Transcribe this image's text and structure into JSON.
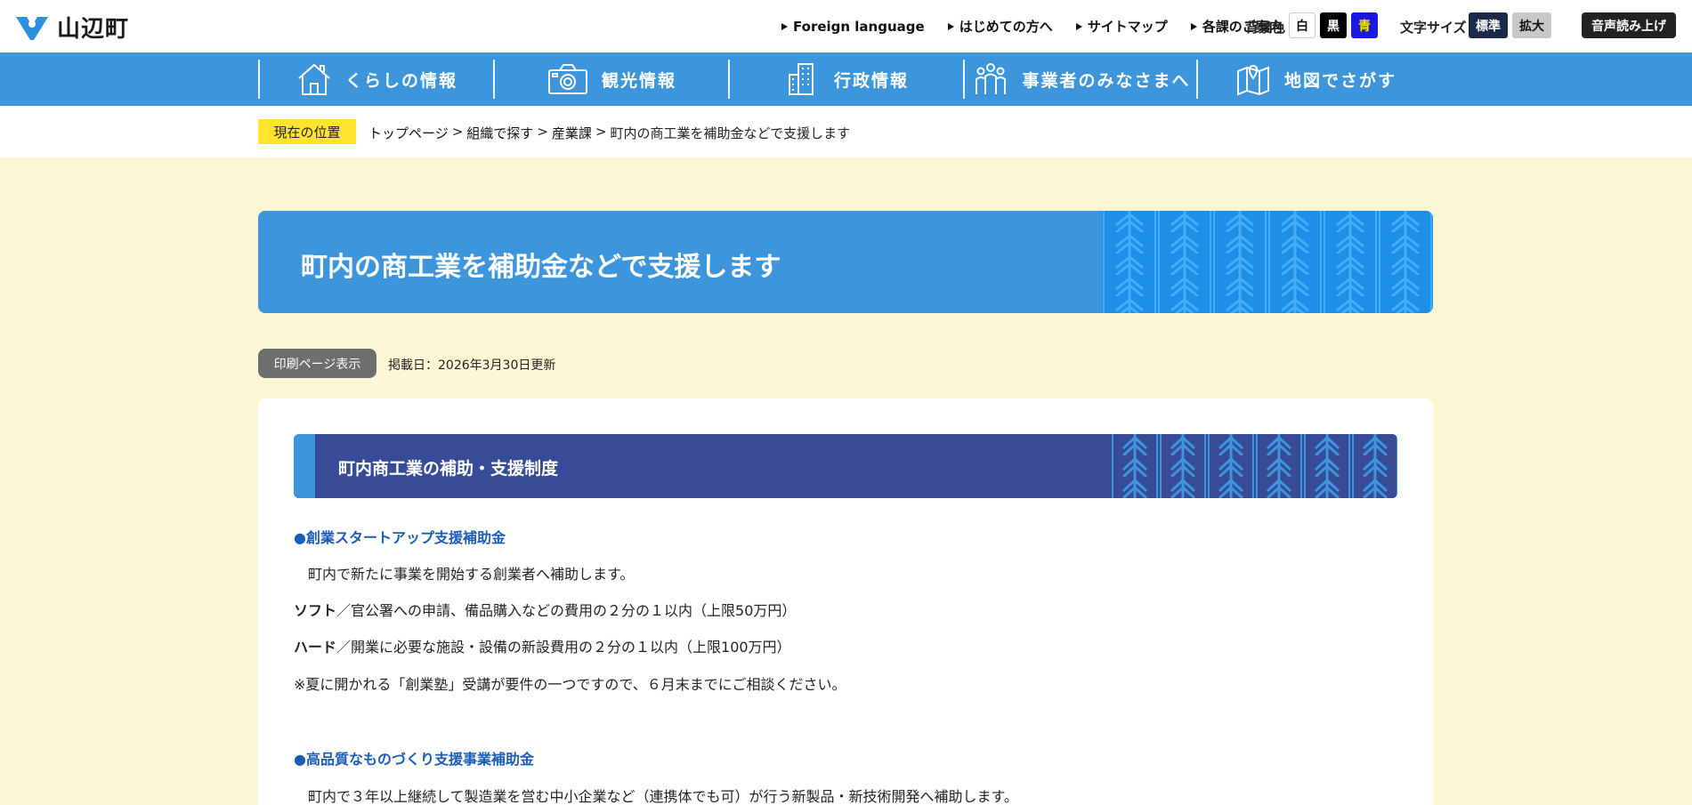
{
  "header": {
    "logo_text": "山辺町",
    "util_links": [
      "Foreign language",
      "はじめての方へ",
      "サイトマップ",
      "各課のご案内"
    ],
    "bg_label": "背景色",
    "bg_white": "白",
    "bg_black": "黒",
    "bg_blue": "青",
    "font_label": "文字サイズ",
    "font_standard": "標準",
    "font_large": "拡大",
    "voice_label": "音声読み上げ"
  },
  "gnav": {
    "items": [
      {
        "label": "くらしの情報",
        "icon": "house-icon"
      },
      {
        "label": "観光情報",
        "icon": "camera-icon"
      },
      {
        "label": "行政情報",
        "icon": "building-icon"
      },
      {
        "label": "事業者のみなさまへ",
        "icon": "people-icon"
      },
      {
        "label": "地図でさがす",
        "icon": "map-icon"
      }
    ]
  },
  "breadcrumb": {
    "here_label": "現在の位置",
    "items": [
      "トップページ",
      "組織で探す",
      "産業課",
      "町内の商工業を補助金などで支援します"
    ],
    "separator": ">"
  },
  "page": {
    "title": "町内の商工業を補助金などで支援します",
    "print_label": "印刷ページ表示",
    "published": "掲載日：2026年3月30日更新"
  },
  "content": {
    "section_title": "町内商工業の補助・支援制度",
    "item1_title": "●創業スタートアップ支援補助金",
    "item1_desc": "町内で新たに事業を開始する創業者へ補助します。",
    "soft_label": "ソフト",
    "soft_text": "／官公署への申請、備品購入などの費用の２分の１以内（上限50万円）",
    "hard_label": "ハード",
    "hard_text": "／開業に必要な施設・設備の新設費用の２分の１以内（上限100万円）",
    "note": "※夏に開かれる「創業塾」受講が要件の一つですので、６月末までにご相談ください。",
    "item2_title": "●高品質なものづくり支援事業補助金",
    "item2_desc": "町内で３年以上継続して製造業を営む中小企業など（連携体でも可）が行う新製品・新技術開発へ補助します。"
  },
  "colors": {
    "nav_blue": "#3d96dc",
    "section_navy": "#374b96",
    "page_bg": "#fdf6d5",
    "here_yellow": "#ffe42e",
    "link_blue": "#1a5cb8"
  }
}
